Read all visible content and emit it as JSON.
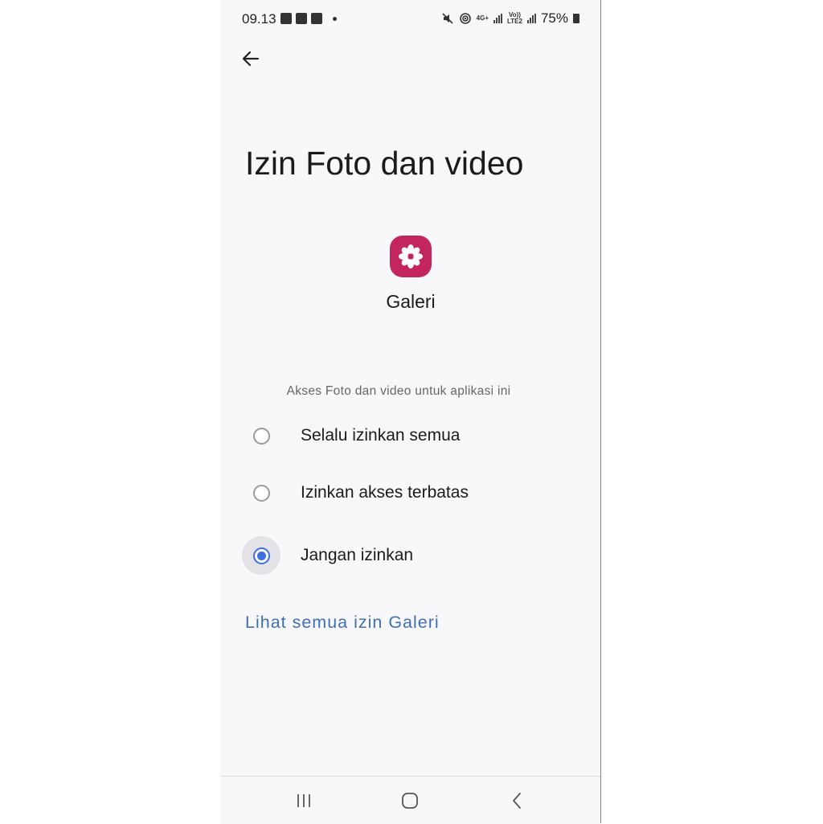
{
  "status_bar": {
    "time": "09.13",
    "network_label_top": "4G+",
    "volte_label": "Vo))",
    "lte_label": "LTE2",
    "battery": "75%",
    "left_icons": [
      "image-icon",
      "shop-icon",
      "shop-icon"
    ],
    "right_icons": [
      "mute-icon",
      "hotspot-icon",
      "signal-icon",
      "signal-icon",
      "battery-icon"
    ]
  },
  "header": {
    "back_icon": "arrow-left-icon",
    "title": "Izin Foto dan video"
  },
  "app": {
    "name": "Galeri",
    "icon": "flower-icon",
    "icon_color": "#c3255f"
  },
  "permissions": {
    "section_label": "Akses Foto dan video untuk aplikasi ini",
    "options": [
      {
        "label": "Selalu izinkan semua",
        "selected": false
      },
      {
        "label": "Izinkan akses terbatas",
        "selected": false
      },
      {
        "label": "Jangan izinkan",
        "selected": true
      }
    ]
  },
  "link": {
    "label": "Lihat semua izin Galeri",
    "color": "#3e70b5"
  },
  "nav_bar": {
    "icons": [
      "recent-apps-icon",
      "home-icon",
      "back-icon"
    ]
  }
}
